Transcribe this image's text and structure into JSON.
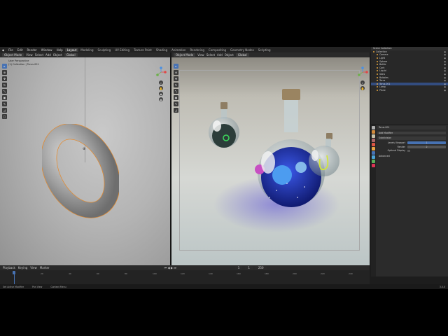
{
  "topbar": {
    "menus": [
      "File",
      "Edit",
      "Render",
      "Window",
      "Help"
    ],
    "workspaces": [
      "Layout",
      "Modeling",
      "Sculpting",
      "UV Editing",
      "Texture Paint",
      "Shading",
      "Animation",
      "Rendering",
      "Compositing",
      "Geometry Nodes",
      "Scripting"
    ],
    "scene": "Scene",
    "view_layer": "ViewLayer"
  },
  "left_header": {
    "mode": "Object Mode",
    "menus": [
      "View",
      "Select",
      "Add",
      "Object"
    ],
    "transform": "Global"
  },
  "left_viewport": {
    "overlay_line1": "User Perspective",
    "overlay_line2": "(1) Collection | Torus.001"
  },
  "right_header": {
    "mode": "Object Mode",
    "menus": [
      "View",
      "Select",
      "Add",
      "Object"
    ],
    "transform": "Global"
  },
  "outliner": {
    "title": "Scene Collection",
    "rows": [
      "Collection",
      "Camera",
      "Light",
      "Sphere",
      "Bottle",
      "Cork",
      "Liquid",
      "Stars",
      "Bubbles",
      "Torus",
      "Torus.001",
      "Lamp",
      "Plane"
    ]
  },
  "properties": {
    "object_name": "Torus.001",
    "modifier": "Subdivision",
    "panel": "Add Modifier",
    "fields": [
      {
        "label": "Levels Viewport",
        "value": "1"
      },
      {
        "label": "Render",
        "value": "2"
      },
      {
        "label": "Optimal Display",
        "value": ""
      }
    ],
    "footer": "Advanced"
  },
  "timeline": {
    "menus": [
      "Playback",
      "Keying",
      "View",
      "Marker"
    ],
    "current_frame": "1",
    "start": "1",
    "end": "250",
    "ticks": [
      "0",
      "20",
      "40",
      "60",
      "80",
      "100",
      "120",
      "140",
      "160",
      "180",
      "200",
      "220",
      "240"
    ]
  },
  "status": {
    "items": [
      "Set Active Modifier",
      "Pan View",
      "Context Menu"
    ],
    "version": "3.0.0"
  },
  "colors": {
    "accent": "#4772b3",
    "selection_outline": "#e38a2e",
    "liquid": "#1f2fb0"
  }
}
